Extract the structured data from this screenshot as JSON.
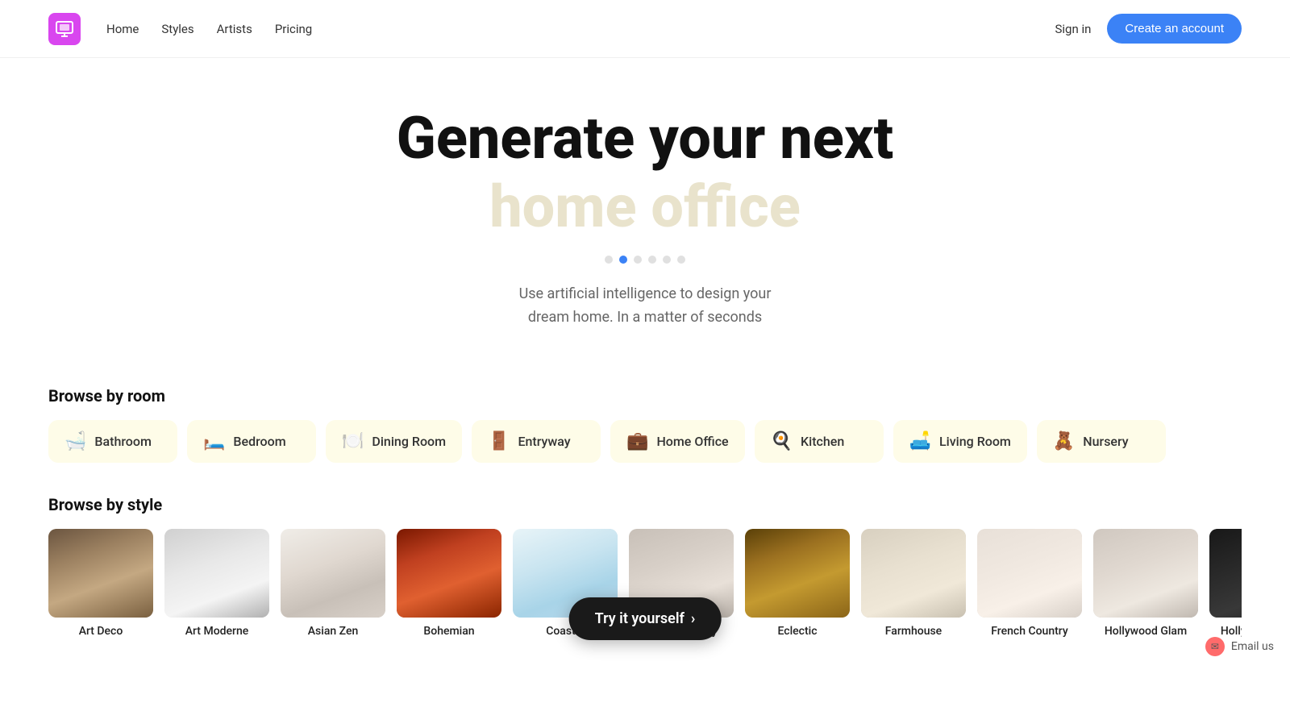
{
  "nav": {
    "logo_alt": "RoomAI Logo",
    "links": [
      {
        "label": "Home",
        "id": "home"
      },
      {
        "label": "Styles",
        "id": "styles"
      },
      {
        "label": "Artists",
        "id": "artists"
      },
      {
        "label": "Pricing",
        "id": "pricing"
      }
    ],
    "sign_in": "Sign in",
    "create_account": "Create an account"
  },
  "hero": {
    "headline": "Generate your next",
    "animated_word": "home office",
    "dots": [
      1,
      2,
      3,
      4,
      5,
      6
    ],
    "active_dot": 1,
    "subtitle_line1": "Use artificial intelligence to design your",
    "subtitle_line2": "dream home. In a matter of seconds"
  },
  "browse_room": {
    "section_title": "Browse by room",
    "rooms": [
      {
        "label": "Bathroom",
        "icon": "🛁",
        "id": "bathroom"
      },
      {
        "label": "Bedroom",
        "icon": "🛏️",
        "id": "bedroom"
      },
      {
        "label": "Dining Room",
        "icon": "🍽️",
        "id": "dining-room"
      },
      {
        "label": "Entryway",
        "icon": "🚪",
        "id": "entryway"
      },
      {
        "label": "Home Office",
        "icon": "💼",
        "id": "home-office"
      },
      {
        "label": "Kitchen",
        "icon": "🍳",
        "id": "kitchen"
      },
      {
        "label": "Living Room",
        "icon": "🛋️",
        "id": "living-room"
      },
      {
        "label": "Nursery",
        "icon": "🧸",
        "id": "nursery"
      }
    ]
  },
  "browse_style": {
    "section_title": "Browse by style",
    "styles": [
      {
        "label": "Art Deco",
        "id": "art-deco",
        "color_start": "#8B7355",
        "color_end": "#6B5B45"
      },
      {
        "label": "Art Moderne",
        "id": "art-moderne",
        "color_start": "#C0C0C0",
        "color_end": "#A0A0A0"
      },
      {
        "label": "Asian Zen",
        "id": "asian-zen",
        "color_start": "#F5F0E8",
        "color_end": "#BDB8B0"
      },
      {
        "label": "Bohemian",
        "id": "bohemian",
        "color_start": "#C45C26",
        "color_end": "#8B2500"
      },
      {
        "label": "Coastal",
        "id": "coastal",
        "color_start": "#E8F4F8",
        "color_end": "#7DB0C8"
      },
      {
        "label": "Contemporary",
        "id": "contemporary",
        "color_start": "#E0DDD8",
        "color_end": "#A8A098"
      },
      {
        "label": "Eclectic",
        "id": "eclectic",
        "color_start": "#8B6914",
        "color_end": "#A07B20"
      },
      {
        "label": "Farmhouse",
        "id": "farmhouse",
        "color_start": "#E8E0D0",
        "color_end": "#B8B0A0"
      },
      {
        "label": "French Country",
        "id": "french-country",
        "color_start": "#F0E8E0",
        "color_end": "#C0B8B0"
      },
      {
        "label": "Hollywood Glam",
        "id": "hollywood-glam-1",
        "color_start": "#E8E0D8",
        "color_end": "#A8A098"
      },
      {
        "label": "Hollywood Glam",
        "id": "hollywood-glam-2",
        "color_start": "#1A1A1A",
        "color_end": "#2A2A2A"
      }
    ]
  },
  "cta": {
    "label": "Try it yourself",
    "arrow": "›"
  },
  "email_us": {
    "label": "Email us"
  }
}
